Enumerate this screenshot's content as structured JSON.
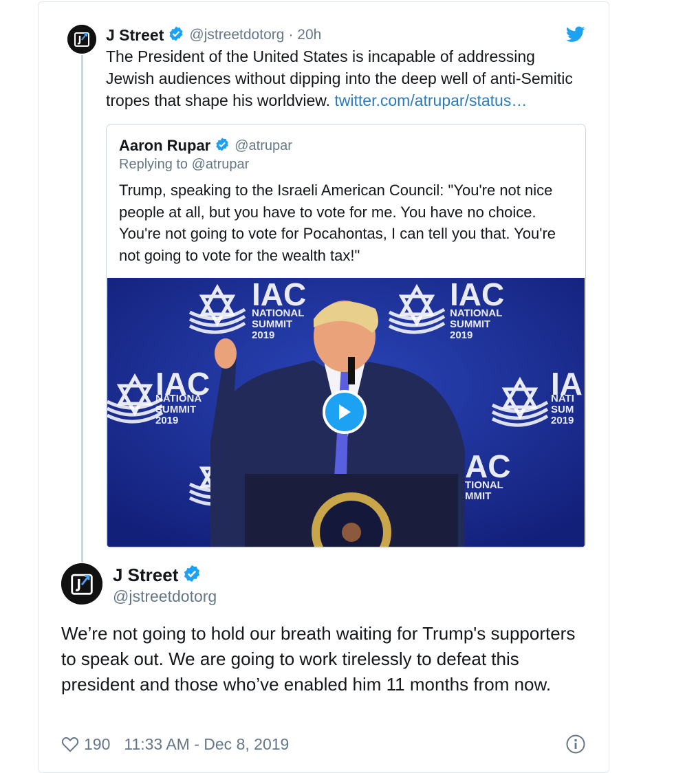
{
  "tweet_main": {
    "author_name": "J Street",
    "author_handle": "@jstreetdotorg",
    "text": "We’re not going to hold our breath waiting for Trump's supporters to speak out. We are going to work tirelessly to defeat this president and those who’ve enabled him 11 months from now.",
    "likes": "190",
    "timestamp": "11:33 AM - Dec 8, 2019",
    "icons": {
      "like": "heart-outline-icon",
      "info": "info-circle-icon",
      "verified": "verified-badge-icon",
      "brand": "twitter-bird-icon"
    }
  },
  "tweet_parent": {
    "author_name": "J Street",
    "author_handle": "@jstreetdotorg",
    "time_ago": "· 20h",
    "text": "The President of the United States is incapable of addressing Jewish audiences without dipping into the deep well of anti-Semitic tropes that shape his worldview.",
    "link_text": "twitter.com/atrupar/status…"
  },
  "quoted_tweet": {
    "author_name": "Aaron Rupar",
    "author_handle": "@atrupar",
    "replying_to": "Replying to @atrupar",
    "text": "Trump, speaking to the Israeli American Council: \"You're not nice people at all, but you have to vote for me. You have no choice. You're not going to vote for Pocahontas, I can tell you that. You're not going to vote for the wealth tax!\""
  },
  "colors": {
    "text": "#14171a",
    "secondary": "#657786",
    "link": "#2b7bb9",
    "brand_blue": "#1da1f2",
    "border": "#e1e8ed",
    "thread_line": "#ccd6dd"
  }
}
